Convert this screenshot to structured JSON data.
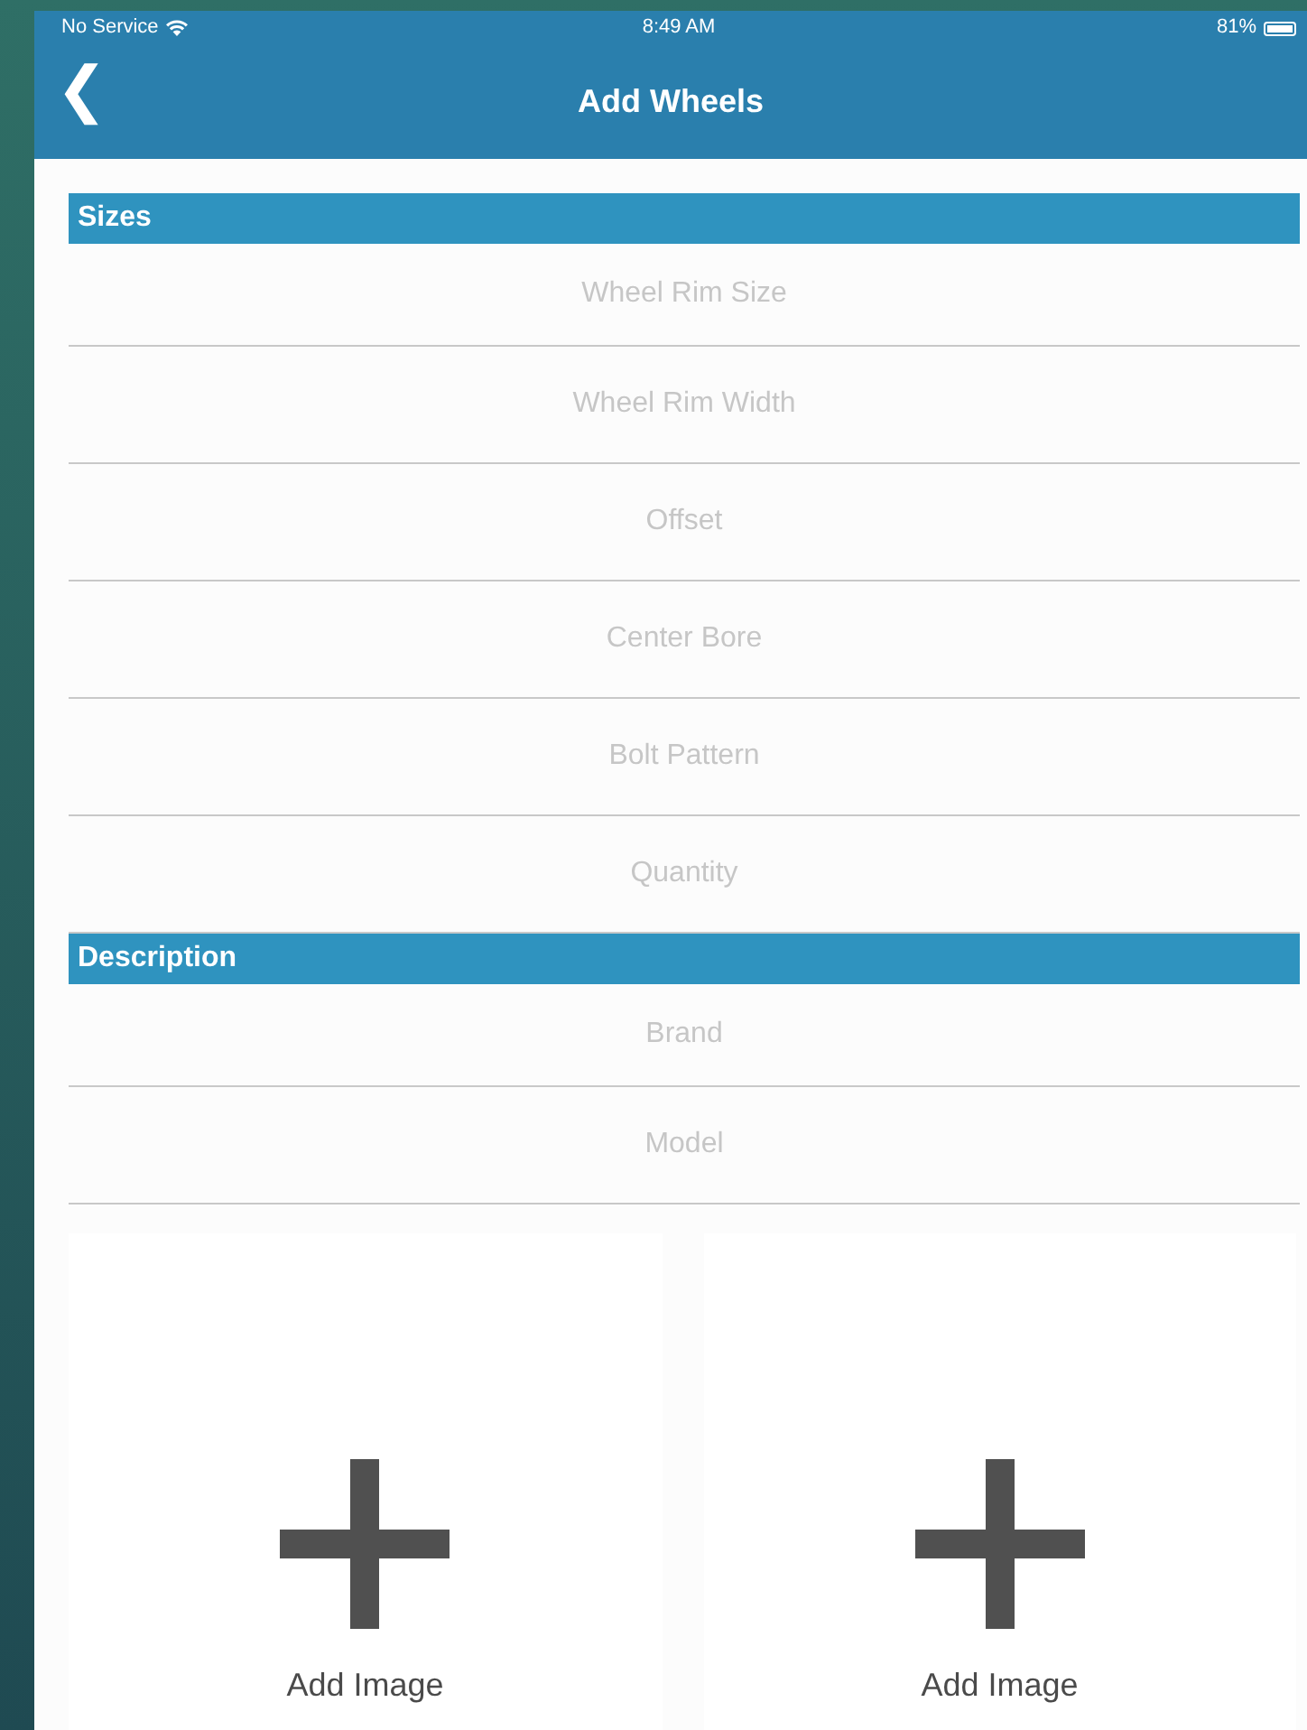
{
  "status_bar": {
    "carrier": "No Service",
    "time": "8:49 AM",
    "battery": "81%"
  },
  "nav_bar": {
    "back": "❮",
    "title": "Add Wheels"
  },
  "sections": [
    {
      "title": "Sizes",
      "fields": [
        {
          "placeholder": "Wheel Rim Size"
        },
        {
          "placeholder": "Wheel Rim Width"
        },
        {
          "placeholder": "Offset"
        },
        {
          "placeholder": "Center Bore"
        },
        {
          "placeholder": "Bolt Pattern"
        },
        {
          "placeholder": "Quantity"
        }
      ]
    },
    {
      "title": "Description",
      "fields": [
        {
          "placeholder": "Brand"
        },
        {
          "placeholder": "Model"
        }
      ]
    }
  ],
  "image_tiles": [
    {
      "label": "Add Image"
    },
    {
      "label": "Add Image"
    }
  ]
}
